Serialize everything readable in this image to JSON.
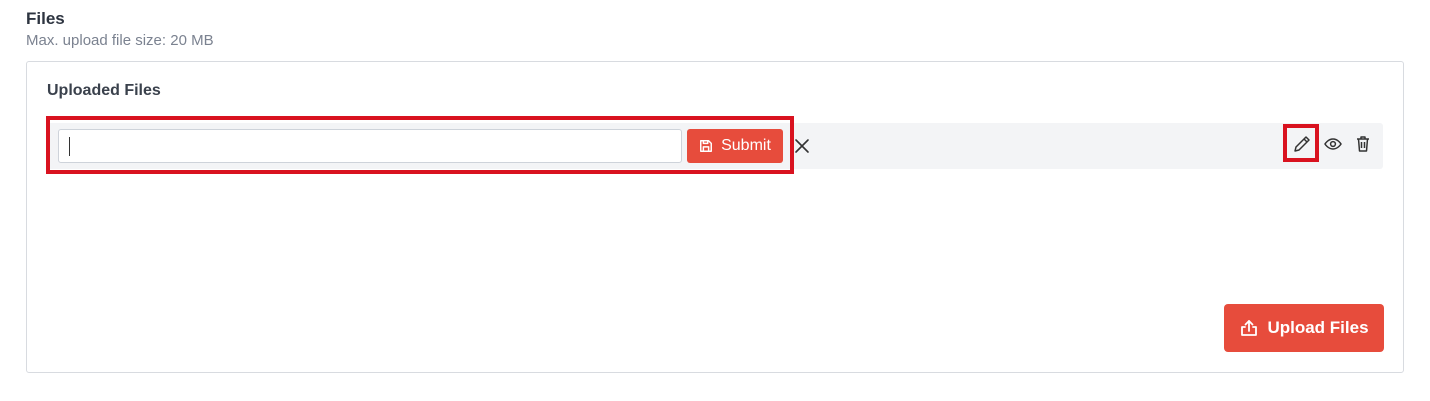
{
  "section": {
    "title": "Files",
    "subtitle": "Max. upload file size: 20 MB"
  },
  "card": {
    "title": "Uploaded Files"
  },
  "edit_form": {
    "input_value": "",
    "submit_label": "Submit"
  },
  "row_actions": {
    "icons": [
      "pencil-icon",
      "eye-icon",
      "trash-icon",
      "close-icon"
    ]
  },
  "upload_button": {
    "label": "Upload Files"
  },
  "colors": {
    "accent": "#e74c3c",
    "highlight": "#d9121f",
    "row_background": "#f3f4f6"
  }
}
